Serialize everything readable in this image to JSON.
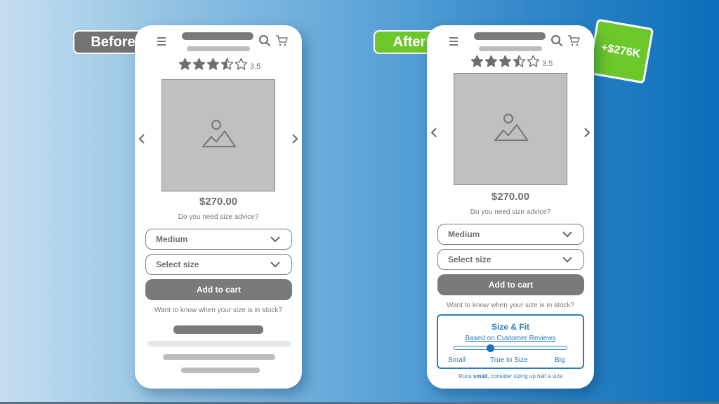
{
  "labels": {
    "before": "Before",
    "after": "After",
    "uplift": "+$276K"
  },
  "product": {
    "rating": "3.5",
    "rating_value": 3.5,
    "rating_max": 5,
    "price": "$270.00",
    "size_advice": "Do you need size advice?",
    "variant_select": "Medium",
    "size_select": "Select size",
    "add_to_cart": "Add to cart",
    "stock_question": "Want to know when your size is in stock?"
  },
  "size_fit": {
    "title": "Size & Fit",
    "subtitle": "Based on Customer Reviews",
    "scale_labels": [
      "Small",
      "True to Size",
      "Big"
    ],
    "position_fraction": 0.32,
    "note_prefix": "Runs ",
    "note_bold": "small",
    "note_suffix": ", consider sizing up half a size"
  },
  "colors": {
    "before_tag": "#737373",
    "after_tag": "#6cc72b",
    "accent_blue": "#2a7bbf"
  }
}
